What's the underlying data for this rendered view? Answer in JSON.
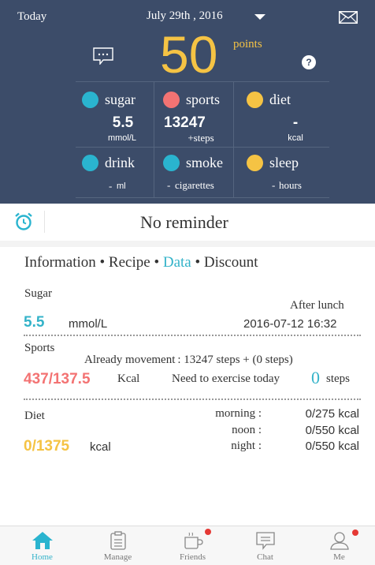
{
  "header": {
    "today": "Today",
    "date": "July 29th , 2016",
    "score": "50",
    "points_label": "points",
    "help": "?"
  },
  "metrics": [
    {
      "name": "sugar",
      "color": "#2ab4cf",
      "value": "5.5",
      "unit": "mmol/L"
    },
    {
      "name": "sports",
      "color": "#f37373",
      "value": "13247",
      "unit": "+steps"
    },
    {
      "name": "diet",
      "color": "#f5c344",
      "value": "-",
      "unit": "kcal"
    },
    {
      "name": "drink",
      "color": "#2ab4cf",
      "value": "-",
      "unit": "ml"
    },
    {
      "name": "smoke",
      "color": "#2ab4cf",
      "value": "-",
      "unit": "cigarettes"
    },
    {
      "name": "sleep",
      "color": "#f5c344",
      "value": "-",
      "unit": "hours"
    }
  ],
  "reminder": "No reminder",
  "tabs": {
    "information": "Information",
    "sep": "•",
    "recipe": "Recipe",
    "data": "Data",
    "discount": "Discount"
  },
  "sugar": {
    "title": "Sugar",
    "meal": "After lunch",
    "value": "5.5",
    "unit": "mmol/L",
    "datetime": "2016-07-12 16:32"
  },
  "sports": {
    "title": "Sports",
    "movement": "Already movement : 13247 steps + (0 steps)",
    "kcal_value": "437/137.5",
    "kcal_unit": "Kcal",
    "need_label": "Need to exercise today",
    "need_value": "0",
    "need_unit": "steps"
  },
  "diet": {
    "title": "Diet",
    "value": "0/1375",
    "unit": "kcal",
    "meals": [
      {
        "label": "morning :",
        "value": "0/275 kcal"
      },
      {
        "label": "noon :",
        "value": "0/550 kcal"
      },
      {
        "label": "night :",
        "value": "0/550 kcal"
      }
    ]
  },
  "nav": [
    {
      "label": "Home",
      "active": true
    },
    {
      "label": "Manage",
      "active": false
    },
    {
      "label": "Friends",
      "active": false
    },
    {
      "label": "Chat",
      "active": false
    },
    {
      "label": "Me",
      "active": false
    }
  ],
  "colors": {
    "header_bg": "#3c4c69",
    "accent": "#34b3c9",
    "score": "#f5c344",
    "sports_red": "#f37373"
  }
}
